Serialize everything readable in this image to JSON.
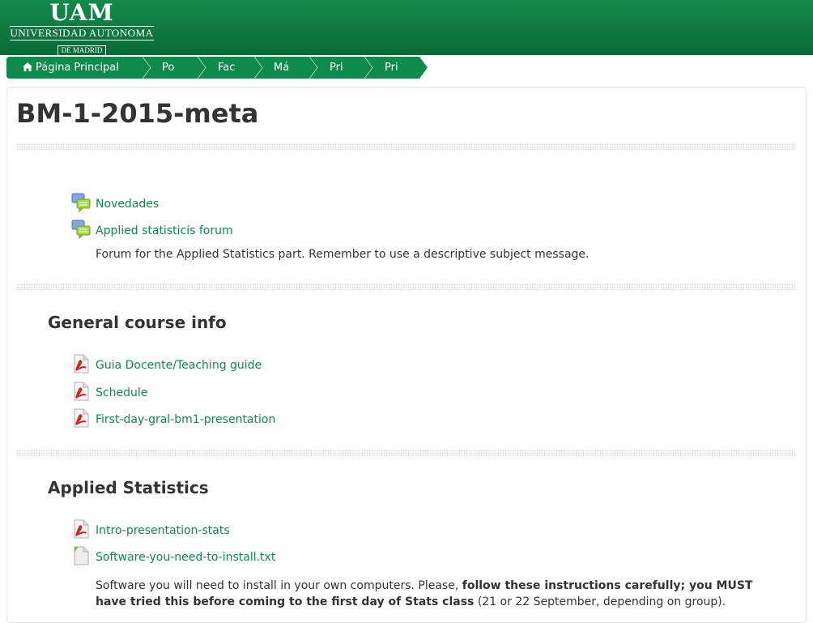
{
  "header": {
    "logo": {
      "uam": "UAM",
      "university": "UNIVERSIDAD AUTONOMA",
      "city": "DE MADRID"
    }
  },
  "breadcrumb": {
    "items": [
      "Página Principal",
      "Po",
      "Fac",
      "Má",
      "Pri",
      "Pri"
    ]
  },
  "course": {
    "title": "BM-1-2015-meta"
  },
  "sections": [
    {
      "title": "",
      "activities": [
        {
          "type": "forum",
          "icon": "forum-icon",
          "name": "Novedades"
        },
        {
          "type": "forum",
          "icon": "forum-icon",
          "name": "Applied statisticis forum"
        }
      ],
      "description": "Forum for the Applied Statistics part. Remember to use a descriptive subject message."
    },
    {
      "title": "General course info",
      "activities": [
        {
          "type": "pdf",
          "icon": "pdf-icon",
          "name": "Guia Docente/Teaching guide"
        },
        {
          "type": "pdf",
          "icon": "pdf-icon",
          "name": "Schedule"
        },
        {
          "type": "pdf",
          "icon": "pdf-icon",
          "name": "First-day-gral-bm1-presentation"
        }
      ]
    },
    {
      "title": "Applied Statistics",
      "activities": [
        {
          "type": "pdf",
          "icon": "pdf-icon",
          "name": "Intro-presentation-stats"
        },
        {
          "type": "text",
          "icon": "text-file-icon",
          "name": "Software-you-need-to-install.txt"
        }
      ],
      "description_parts": {
        "p1": "Software you will need to install in your own computers. Please, ",
        "bold1": "follow these instructions carefully; you MUST",
        "bold2": "have tried this before coming to the first day of Stats class",
        "p2": " (21 or 22 September, depending on group)."
      }
    }
  ],
  "colors": {
    "brand_green": "#0e7a40",
    "link_green": "#0e8a4a"
  }
}
